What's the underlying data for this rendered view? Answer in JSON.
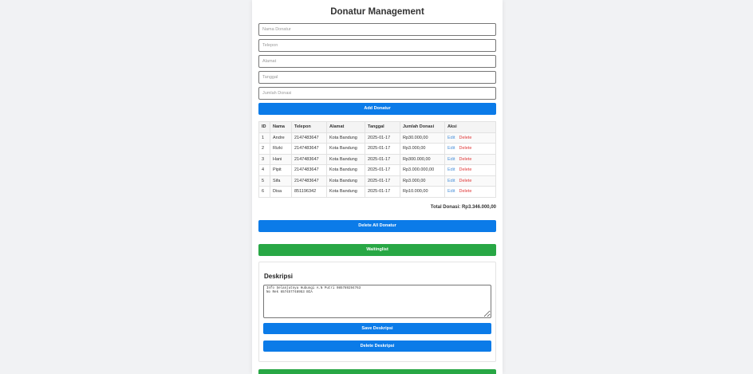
{
  "header": {
    "title": "Donatur Management"
  },
  "form": {
    "nama_placeholder": "Nama Donatur",
    "telepon_placeholder": "Telepon",
    "alamat_placeholder": "Alamat",
    "tanggal_placeholder": "Tanggal",
    "jumlah_placeholder": "Jumlah Donasi",
    "add_label": "Add Donatur"
  },
  "table": {
    "headers": [
      "ID",
      "Nama",
      "Telepon",
      "Alamat",
      "Tanggal",
      "Jumlah Donasi",
      "Aksi"
    ],
    "edit_label": "Edit",
    "delete_label": "Delete",
    "rows": [
      [
        "1",
        "Andre",
        "2147483647",
        "Kota Bandung",
        "2025-01-17",
        "Rp30.000,00"
      ],
      [
        "2",
        "Rizki",
        "2147483647",
        "Kota Bandung",
        "2025-01-17",
        "Rp3.000,00"
      ],
      [
        "3",
        "Hani",
        "2147483647",
        "Kota Bandung",
        "2025-01-17",
        "Rp300.000,00"
      ],
      [
        "4",
        "Pipit",
        "2147483647",
        "Kota Bandung",
        "2025-01-17",
        "Rp3.000.000,00"
      ],
      [
        "5",
        "Sifa",
        "2147483647",
        "Kota Bandung",
        "2025-01-17",
        "Rp3.000,00"
      ],
      [
        "6",
        "Disa",
        "851196342",
        "Kota Bandung",
        "2025-01-17",
        "Rp10.000,00"
      ]
    ]
  },
  "summary": {
    "total": "Total Donasi: Rp3.346.000,00"
  },
  "actions": {
    "delete_all_label": "Delete All Donatur",
    "waitinglist_label": "Waitinglist"
  },
  "deskripsi": {
    "title": "Deskripsi",
    "text": "Info Selanjutnya Hubungi A.N Putri 085789294763\nNo Rek 657457748953 BCA",
    "save_label": "Save Deskripsi",
    "delete_label": "Delete Deskripsi"
  },
  "colors": {
    "primary": "#0b7be8",
    "success": "#28a745",
    "danger": "#e03a3a",
    "link": "#4a90d9"
  }
}
